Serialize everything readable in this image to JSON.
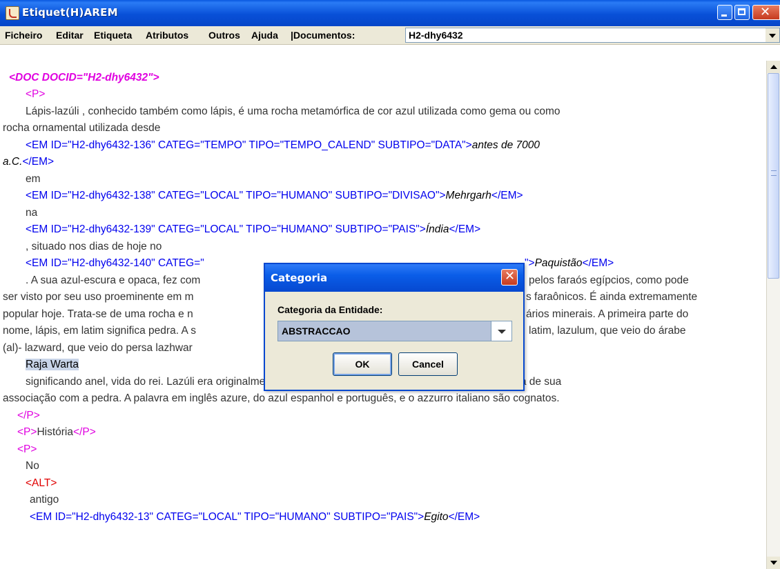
{
  "window": {
    "title": "Etiquet(H)AREM"
  },
  "menu": {
    "items": [
      "Ficheiro",
      "Editar",
      "Etiqueta",
      "Atributos",
      "Outros",
      "Ajuda",
      "|Documentos:"
    ],
    "documents_value": "H2-dhy6432"
  },
  "doc": {
    "l01": "<DOC DOCID=\"H2-dhy6432\">",
    "l02": "<P>",
    "l03": "Lápis-lazúli , conhecido também como lápis, é uma rocha metamórfica de cor azul utilizada como gema ou como",
    "l04": "rocha ornamental utilizada desde",
    "l05a": "<EM ID=\"H2-dhy6432-136\" CATEG=\"TEMPO\" TIPO=\"TEMPO_CALEND\" SUBTIPO=\"DATA\">",
    "l05b": "antes de 7000",
    "l06a": "a.C.",
    "l06b": "</EM>",
    "l07": "em",
    "l08a": "<EM ID=\"H2-dhy6432-138\" CATEG=\"LOCAL\" TIPO=\"HUMANO\" SUBTIPO=\"DIVISAO\">",
    "l08b": "Mehrgarh",
    "l08c": "</EM>",
    "l09": "na",
    "l10a": "<EM ID=\"H2-dhy6432-139\" CATEG=\"LOCAL\" TIPO=\"HUMANO\" SUBTIPO=\"PAIS\">",
    "l10b": "Índia",
    "l10c": "</EM>",
    "l11": ", situado nos dias de hoje no",
    "l12a": "<EM ID=\"H2-dhy6432-140\" CATEG=\"",
    "l12b": "\">",
    "l12c": "Paquistão",
    "l12d": "</EM>",
    "l13a": ". A sua azul-escura e opaca, fez com",
    "l13b": "pelos faraós egípcios, como pode",
    "l14a": "ser visto por seu uso proeminente em m",
    "l14b": "s faraônicos. É ainda extremamente",
    "l15a": "popular hoje. Trata-se de uma rocha e n",
    "l15b": "ários minerais. A primeira parte do",
    "l16a": "nome, lápis, em latim significa pedra. A s",
    "l16b": "latim, lazulum, que veio do árabe",
    "l17": "(al)- lazward, que veio do persa lazhwar",
    "l18": "Raja Warta",
    "l19": "significando anel, vida do rei. Lazúli era originalmente um nome, mas logo veio a significar azul por causa de sua",
    "l20": "associação com a pedra. A palavra em inglês azure, do azul espanhol e português, e o azzurro italiano são cognatos.",
    "l21": "</P>",
    "l22a": "<P>",
    "l22b": "História",
    "l22c": "</P>",
    "l23": "<P>",
    "l24": "No",
    "l25": "<ALT>",
    "l26": "antigo",
    "l27a": "<EM ID=\"H2-dhy6432-13\" CATEG=\"LOCAL\" TIPO=\"HUMANO\" SUBTIPO=\"PAIS\">",
    "l27b": "Egito",
    "l27c": "</EM>"
  },
  "dialog": {
    "title": "Categoria",
    "label": "Categoria da Entidade:",
    "selected": "ABSTRACCAO",
    "ok_label": "OK",
    "cancel_label": "Cancel"
  },
  "colors": {
    "title_bar": "#0a58e0",
    "p_tag": "#e000e0",
    "em_tag": "#0000ee",
    "alt_tag": "#e00000",
    "selection": "#c8d4e8"
  }
}
